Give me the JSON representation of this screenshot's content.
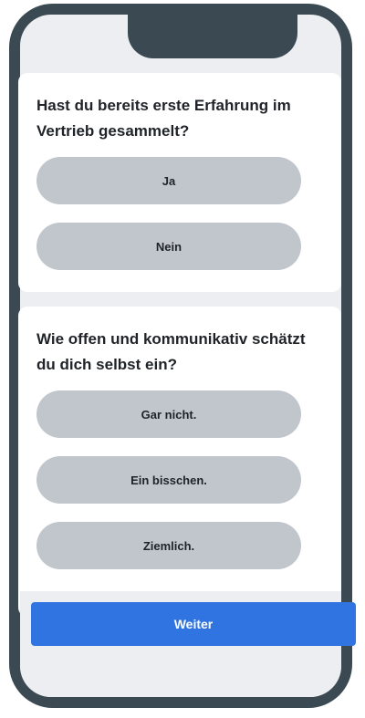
{
  "questions": [
    {
      "text": "Hast du bereits erste Erfahrung im Vertrieb gesammelt?",
      "options": [
        "Ja",
        "Nein"
      ]
    },
    {
      "text": "Wie offen und kommunikativ schätzt du dich selbst ein?",
      "options": [
        "Gar nicht.",
        "Ein bisschen.",
        "Ziemlich."
      ]
    }
  ],
  "footer": {
    "next_label": "Weiter"
  },
  "colors": {
    "accent": "#2f74e0",
    "option_bg": "#c1c6cc",
    "frame": "#3b4a52",
    "screen_bg": "#eceef1"
  }
}
